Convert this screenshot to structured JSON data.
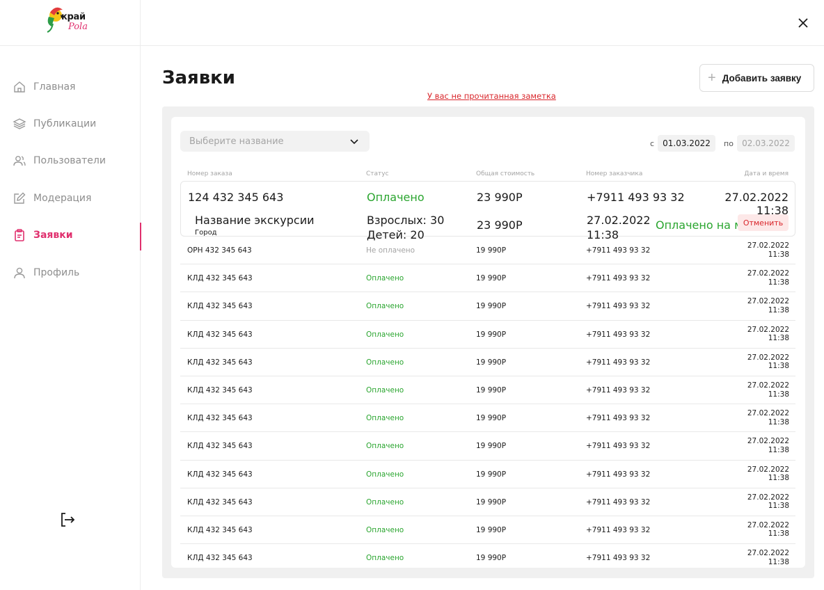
{
  "brand": {
    "name": "край",
    "script": "Pola"
  },
  "sidebar": {
    "items": [
      {
        "label": "Главная",
        "icon": "home-icon"
      },
      {
        "label": "Публикации",
        "icon": "layers-icon"
      },
      {
        "label": "Пользователи",
        "icon": "users-icon"
      },
      {
        "label": "Модерация",
        "icon": "edit-icon"
      },
      {
        "label": "Заявки",
        "icon": "clipboard-icon",
        "active": true
      },
      {
        "label": "Профиль",
        "icon": "user-icon"
      }
    ]
  },
  "header": {
    "title": "Заявки",
    "notice": "У вас не прочитанная заметка",
    "add_button": "Добавить заявку"
  },
  "filters": {
    "select_placeholder": "Выберите название",
    "from_label": "с",
    "from_value": "01.03.2022",
    "to_label": "по",
    "to_value": "02.03.2022"
  },
  "table": {
    "columns": [
      "Номер заказа",
      "Статус",
      "Общая стоимость",
      "Номер заказчика",
      "Дата и время"
    ],
    "expanded": {
      "number": "124 432 345 643",
      "status": "Оплачено",
      "cost": "23 990Р",
      "phone": "+7911 493 93 32",
      "date": "27.02.2022",
      "time": "11:38",
      "detail": {
        "excursion": "Название экскурсии",
        "city": "Город",
        "adults": "Взрослых: 30",
        "children": "Детей: 20",
        "cost": "23 990Р",
        "date": "27.02.2022",
        "time": "11:38",
        "payment": "Оплачено на месте",
        "cancel": "Отменить"
      }
    },
    "rows": [
      {
        "number": "ОРН 432 345 643",
        "status": "Не оплачено",
        "cost": "19 990Р",
        "phone": "+7911 493 93 32",
        "date": "27.02.2022",
        "time": "11:38"
      },
      {
        "number": "КЛД 432 345 643",
        "status": "Оплачено",
        "cost": "19 990Р",
        "phone": "+7911 493 93 32",
        "date": "27.02.2022",
        "time": "11:38"
      },
      {
        "number": "КЛД 432 345 643",
        "status": "Оплачено",
        "cost": "19 990Р",
        "phone": "+7911 493 93 32",
        "date": "27.02.2022",
        "time": "11:38"
      },
      {
        "number": "КЛД 432 345 643",
        "status": "Оплачено",
        "cost": "19 990Р",
        "phone": "+7911 493 93 32",
        "date": "27.02.2022",
        "time": "11:38"
      },
      {
        "number": "КЛД 432 345 643",
        "status": "Оплачено",
        "cost": "19 990Р",
        "phone": "+7911 493 93 32",
        "date": "27.02.2022",
        "time": "11:38"
      },
      {
        "number": "КЛД 432 345 643",
        "status": "Оплачено",
        "cost": "19 990Р",
        "phone": "+7911 493 93 32",
        "date": "27.02.2022",
        "time": "11:38"
      },
      {
        "number": "КЛД 432 345 643",
        "status": "Оплачено",
        "cost": "19 990Р",
        "phone": "+7911 493 93 32",
        "date": "27.02.2022",
        "time": "11:38"
      },
      {
        "number": "КЛД 432 345 643",
        "status": "Оплачено",
        "cost": "19 990Р",
        "phone": "+7911 493 93 32",
        "date": "27.02.2022",
        "time": "11:38"
      },
      {
        "number": "КЛД 432 345 643",
        "status": "Оплачено",
        "cost": "19 990Р",
        "phone": "+7911 493 93 32",
        "date": "27.02.2022",
        "time": "11:38"
      },
      {
        "number": "КЛД 432 345 643",
        "status": "Оплачено",
        "cost": "19 990Р",
        "phone": "+7911 493 93 32",
        "date": "27.02.2022",
        "time": "11:38"
      },
      {
        "number": "КЛД 432 345 643",
        "status": "Оплачено",
        "cost": "19 990Р",
        "phone": "+7911 493 93 32",
        "date": "27.02.2022",
        "time": "11:38"
      },
      {
        "number": "КЛД 432 345 643",
        "status": "Оплачено",
        "cost": "19 990Р",
        "phone": "+7911 493 93 32",
        "date": "27.02.2022",
        "time": "11:38"
      }
    ]
  },
  "colors": {
    "accent": "#e0306e",
    "paid": "#2aa52f",
    "danger": "#d9262b"
  }
}
